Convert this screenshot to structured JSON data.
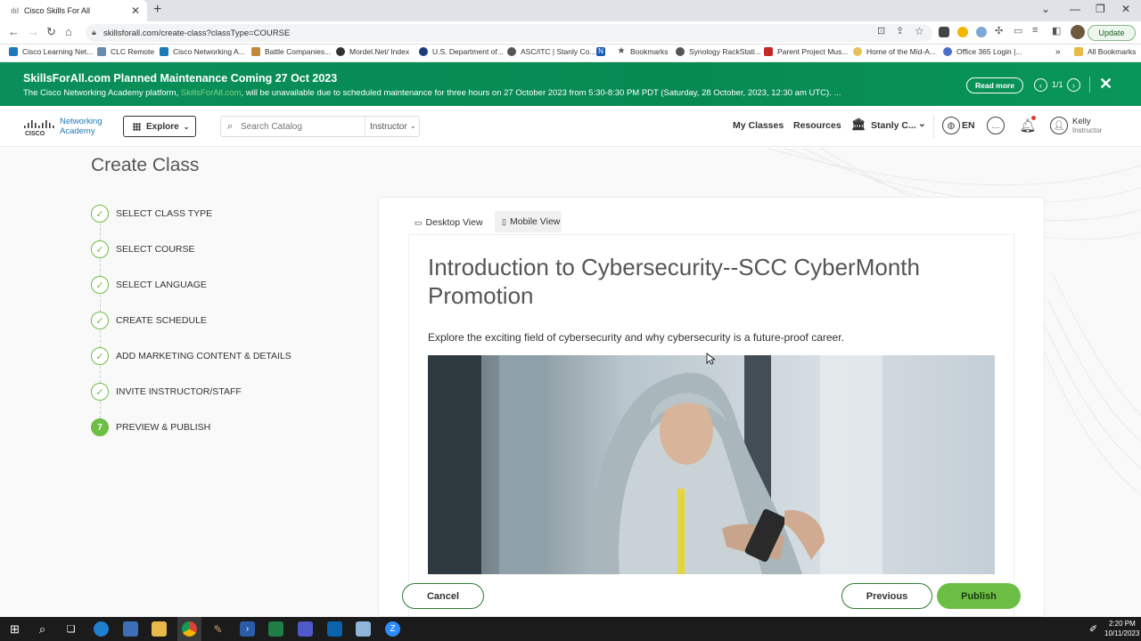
{
  "browser": {
    "tab_title": "Cisco Skills For All",
    "url": "skillsforall.com/create-class?classType=COURSE",
    "update_label": "Update",
    "bookmarks": [
      "Cisco Learning Net...",
      "CLC Remote",
      "Cisco Networking A...",
      "Battle Companies...",
      "Mordel.Net/ Index",
      "U.S. Department of...",
      "ASC/ITC | Stanly Co...",
      "Bookmarks",
      "Synology RackStati...",
      "Parent Project Mus...",
      "Home of the Mid-A...",
      "Office 365 Login |..."
    ],
    "all_bookmarks": "All Bookmarks"
  },
  "banner": {
    "title": "SkillsForAll.com Planned Maintenance Coming 27 Oct 2023",
    "text_before": "The Cisco Networking Academy platform, ",
    "text_link": "SkillsForAll.com",
    "text_after": ", will be unavailable due to scheduled maintenance for three hours on 27 October 2023 from 5:30-8:30 PM PDT (Saturday, 28 October, 2023, 12:30 am UTC). ...",
    "read_more": "Read more",
    "pager": "1/1"
  },
  "header": {
    "logo_line1": "Networking",
    "logo_line2": "Academy",
    "explore": "Explore",
    "search_placeholder": "Search Catalog",
    "role": "Instructor",
    "my_classes": "My Classes",
    "resources": "Resources",
    "institution": "Stanly C...",
    "language": "EN",
    "user_name": "Kelly",
    "user_role": "Instructor"
  },
  "page": {
    "title": "Create Class",
    "steps": [
      {
        "label": "SELECT CLASS TYPE",
        "marker": "✓"
      },
      {
        "label": "SELECT COURSE",
        "marker": "✓"
      },
      {
        "label": "SELECT LANGUAGE",
        "marker": "✓"
      },
      {
        "label": "CREATE SCHEDULE",
        "marker": "✓"
      },
      {
        "label": "ADD MARKETING CONTENT & DETAILS",
        "marker": "✓"
      },
      {
        "label": "INVITE INSTRUCTOR/STAFF",
        "marker": "✓"
      },
      {
        "label": "PREVIEW & PUBLISH",
        "marker": "7"
      }
    ],
    "desktop_view": "Desktop View",
    "mobile_view": "Mobile View",
    "course_title": "Introduction to Cybersecurity--SCC CyberMonth Promotion",
    "course_desc": "Explore the exciting field of cybersecurity and why cybersecurity is a future-proof career.",
    "cancel": "Cancel",
    "previous": "Previous",
    "publish": "Publish"
  },
  "taskbar": {
    "time": "2:20 PM",
    "date": "10/11/2023"
  },
  "colors": {
    "accent_green": "#6cbe45",
    "banner_green": "#078a52",
    "button_border": "#2e7d32"
  }
}
